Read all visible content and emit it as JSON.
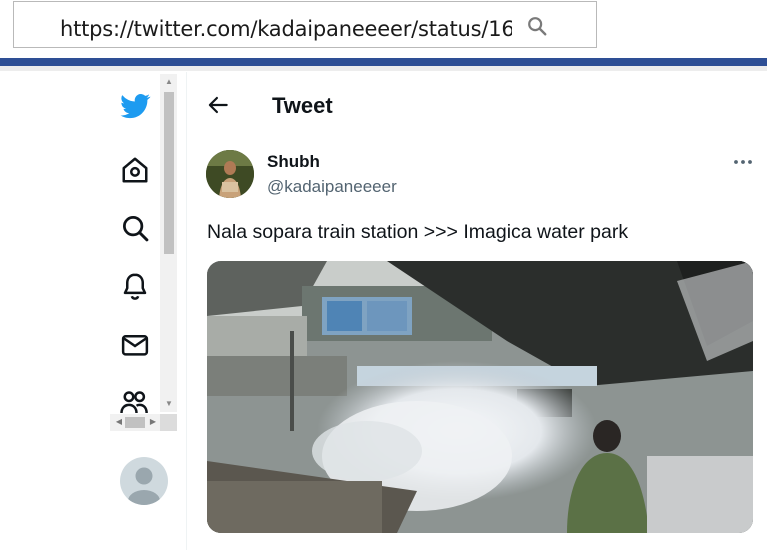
{
  "browser": {
    "url": "https://twitter.com/kadaipaneeeer/status/16",
    "search_icon": "search-icon"
  },
  "nav": {
    "items": [
      {
        "icon": "twitter-logo-icon"
      },
      {
        "icon": "home-icon"
      },
      {
        "icon": "explore-search-icon"
      },
      {
        "icon": "notifications-bell-icon"
      },
      {
        "icon": "messages-envelope-icon"
      },
      {
        "icon": "communities-icon"
      }
    ],
    "profile_avatar": "default-avatar"
  },
  "header": {
    "back_icon": "back-arrow-icon",
    "title": "Tweet"
  },
  "tweet": {
    "author_name": "Shubh",
    "author_handle": "@kadaipaneeeer",
    "text": "Nala sopara train station >>> Imagica water park",
    "more_icon": "more-dots-icon",
    "media": "video-still"
  },
  "colors": {
    "brand_blue": "#1d9bf0",
    "browser_strip": "#2e4f95",
    "secondary_text": "#536471"
  }
}
